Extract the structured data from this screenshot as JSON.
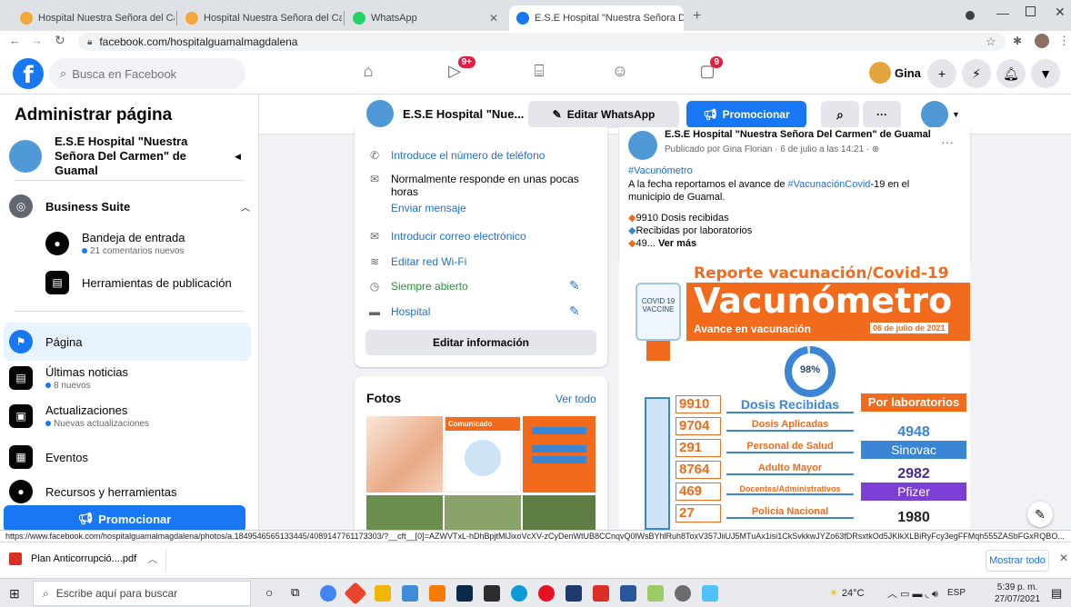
{
  "browser": {
    "tabs": [
      {
        "title": "Hospital Nuestra Señora del Carm"
      },
      {
        "title": "Hospital Nuestra Señora del Carm"
      },
      {
        "title": "WhatsApp"
      },
      {
        "title": "E.S.E Hospital \"Nuestra Señora D"
      }
    ],
    "new_tab": "+",
    "url": "facebook.com/hospitalguamalmagdalena",
    "status_url": "https://www.facebook.com/hospitalguamalmagdalena/photos/a.1849546565133445/4089147761173303/?__cft__[0]=AZWVTxL-hDhBpjtMlJixoVcXV-zCyDenWtUB8CCnqvQ0lWsBYhlRuh8ToxV357JiiUJ5MTuAx1isi1CkSvkkwJYZo63fDRsxtkOd5JKIkXLBiRyFcy3egFFMqh555ZASbFGxRQBO..."
  },
  "fb": {
    "search_placeholder": "Busca en Facebook",
    "watch_badge": "9+",
    "notif_badge": "9",
    "user_name": "Gina"
  },
  "sidebar": {
    "title": "Administrar página",
    "page_name": "E.S.E Hospital \"Nuestra Señora Del Carmen\" de Guamal",
    "business_suite": "Business Suite",
    "inbox": {
      "label": "Bandeja de entrada",
      "sub": "21 comentarios nuevos"
    },
    "publishing_tools": "Herramientas de publicación",
    "items": [
      {
        "label": "Página",
        "sub": ""
      },
      {
        "label": "Últimas noticias",
        "sub": "8 nuevos"
      },
      {
        "label": "Actualizaciones",
        "sub": "Nuevas actualizaciones"
      },
      {
        "label": "Eventos",
        "sub": ""
      },
      {
        "label": "Recursos y herramientas",
        "sub": ""
      }
    ],
    "promote": "Promocionar"
  },
  "pagebar": {
    "page_name": "E.S.E Hospital \"Nue...",
    "edit_whatsapp": "Editar WhatsApp",
    "promote": "Promocionar",
    "more": "···"
  },
  "about": {
    "phone": "Introduce el número de teléfono",
    "response": "Normalmente responde en unas pocas horas",
    "send_message": "Enviar mensaje",
    "email": "Introducir correo electrónico",
    "wifi": "Editar red Wi-Fi",
    "hours": "Siempre abierto",
    "category": "Hospital",
    "edit_info": "Editar información"
  },
  "photos": {
    "title": "Fotos",
    "see_all": "Ver todo",
    "thumb_text": "Comunicado"
  },
  "post": {
    "author": "E.S.E Hospital \"Nuestra Señora Del Carmen\" de Guamal",
    "meta": "Publicado por Gina Florian · 6 de julio a las 14:21 ·",
    "hashtag": "#Vacunómetro",
    "text_1": "A la fecha reportamos el avance de",
    "text_tag": "#VacunaciónCovid",
    "text_2": "-19 en el municipio de Guamal.",
    "line_1": "9910 Dosis recibidas",
    "line_2": "Recibidas por laboratorios",
    "line_3": "49...",
    "see_more": "Ver más"
  },
  "vaccine_graphic": {
    "header": "Reporte vacunación/Covid-19",
    "title": "Vacunómetro",
    "subtitle": "Avance en vacunación",
    "date": "06 de julio de 2021",
    "vial_label": "COVID 19 VACCINE",
    "percent": "98%",
    "rows": [
      {
        "value": "9910",
        "label": "Dosis Recibidas"
      },
      {
        "value": "9704",
        "label": "Dosis Aplicadas"
      },
      {
        "value": "291",
        "label": "Personal de Salud"
      },
      {
        "value": "8764",
        "label": "Adulto Mayor"
      },
      {
        "value": "469",
        "label": "Docentes/Administrativos"
      },
      {
        "value": "27",
        "label": "Policía Nacional"
      }
    ],
    "labs_title": "Por laboratorios",
    "labs": [
      {
        "value": "4948",
        "name": "Sinovac",
        "color": "#3a86d4"
      },
      {
        "value": "2982",
        "name": "Pfizer",
        "color": "#7b3fd6"
      },
      {
        "value": "1980",
        "name": ""
      }
    ]
  },
  "download": {
    "file": "Plan Anticorrupció....pdf",
    "show_all": "Mostrar todo"
  },
  "taskbar": {
    "search": "Escribe aquí para buscar",
    "weather": "24°C",
    "lang": "ESP",
    "time": "5:39 p. m.",
    "date": "27/07/2021"
  },
  "colors": {
    "fb_blue": "#1877f2",
    "orange": "#f26a1b",
    "page_bg": "#f0f2f5"
  }
}
